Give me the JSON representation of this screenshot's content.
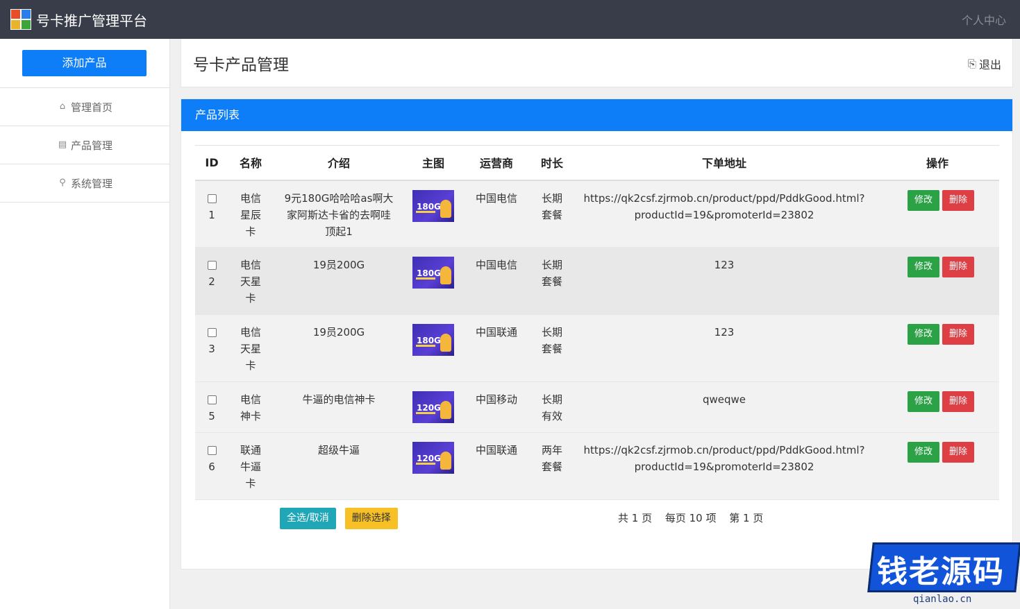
{
  "app": {
    "title": "号卡推广管理平台",
    "user_center": "个人中心"
  },
  "sidebar": {
    "add_button": "添加产品",
    "items": [
      {
        "label": "管理首页",
        "icon": "home-icon"
      },
      {
        "label": "产品管理",
        "icon": "document-icon"
      },
      {
        "label": "系统管理",
        "icon": "user-icon"
      }
    ]
  },
  "header": {
    "title": "号卡产品管理",
    "logout": "退出"
  },
  "list": {
    "heading": "产品列表",
    "columns": [
      "ID",
      "名称",
      "介绍",
      "主图",
      "运营商",
      "时长",
      "下单地址",
      "操作"
    ],
    "rows": [
      {
        "id": "1",
        "name": "电信星辰卡",
        "intro": "9元180G哈哈哈as啊大家阿斯达卡省的去啊哇顶起1",
        "image_label": "180G",
        "carrier": "中国电信",
        "duration": "长期套餐",
        "url": "https://qk2csf.zjrmob.cn/product/ppd/PddkGood.html?productId=19&promoterId=23802"
      },
      {
        "id": "2",
        "name": "电信天星卡",
        "intro": "19员200G",
        "image_label": "180G",
        "carrier": "中国电信",
        "duration": "长期套餐",
        "url": "123"
      },
      {
        "id": "3",
        "name": "电信天星卡",
        "intro": "19员200G",
        "image_label": "180G",
        "carrier": "中国联通",
        "duration": "长期套餐",
        "url": "123"
      },
      {
        "id": "5",
        "name": "电信神卡",
        "intro": "牛逼的电信神卡",
        "image_label": "120G",
        "carrier": "中国移动",
        "duration": "长期有效",
        "url": "qweqwe"
      },
      {
        "id": "6",
        "name": "联通牛逼卡",
        "intro": "超级牛逼",
        "image_label": "120G",
        "carrier": "中国联通",
        "duration": "两年套餐",
        "url": "https://qk2csf.zjrmob.cn/product/ppd/PddkGood.html?productId=19&promoterId=23802"
      }
    ],
    "edit_label": "修改",
    "delete_label": "删除",
    "select_all_label": "全选/取消",
    "delete_selected_label": "删除选择",
    "pager": {
      "total_pages": "共 1 页",
      "per_page": "每页 10 项",
      "current": "第 1 页"
    }
  },
  "watermark": {
    "text": "钱老源码",
    "url": "qianlao.cn"
  },
  "colors": {
    "topbar": "#393d49",
    "primary": "#0d7ef8",
    "edit": "#2ba246",
    "delete": "#de3f45",
    "select_all": "#1fa7b8",
    "delete_selected": "#f6c026"
  }
}
